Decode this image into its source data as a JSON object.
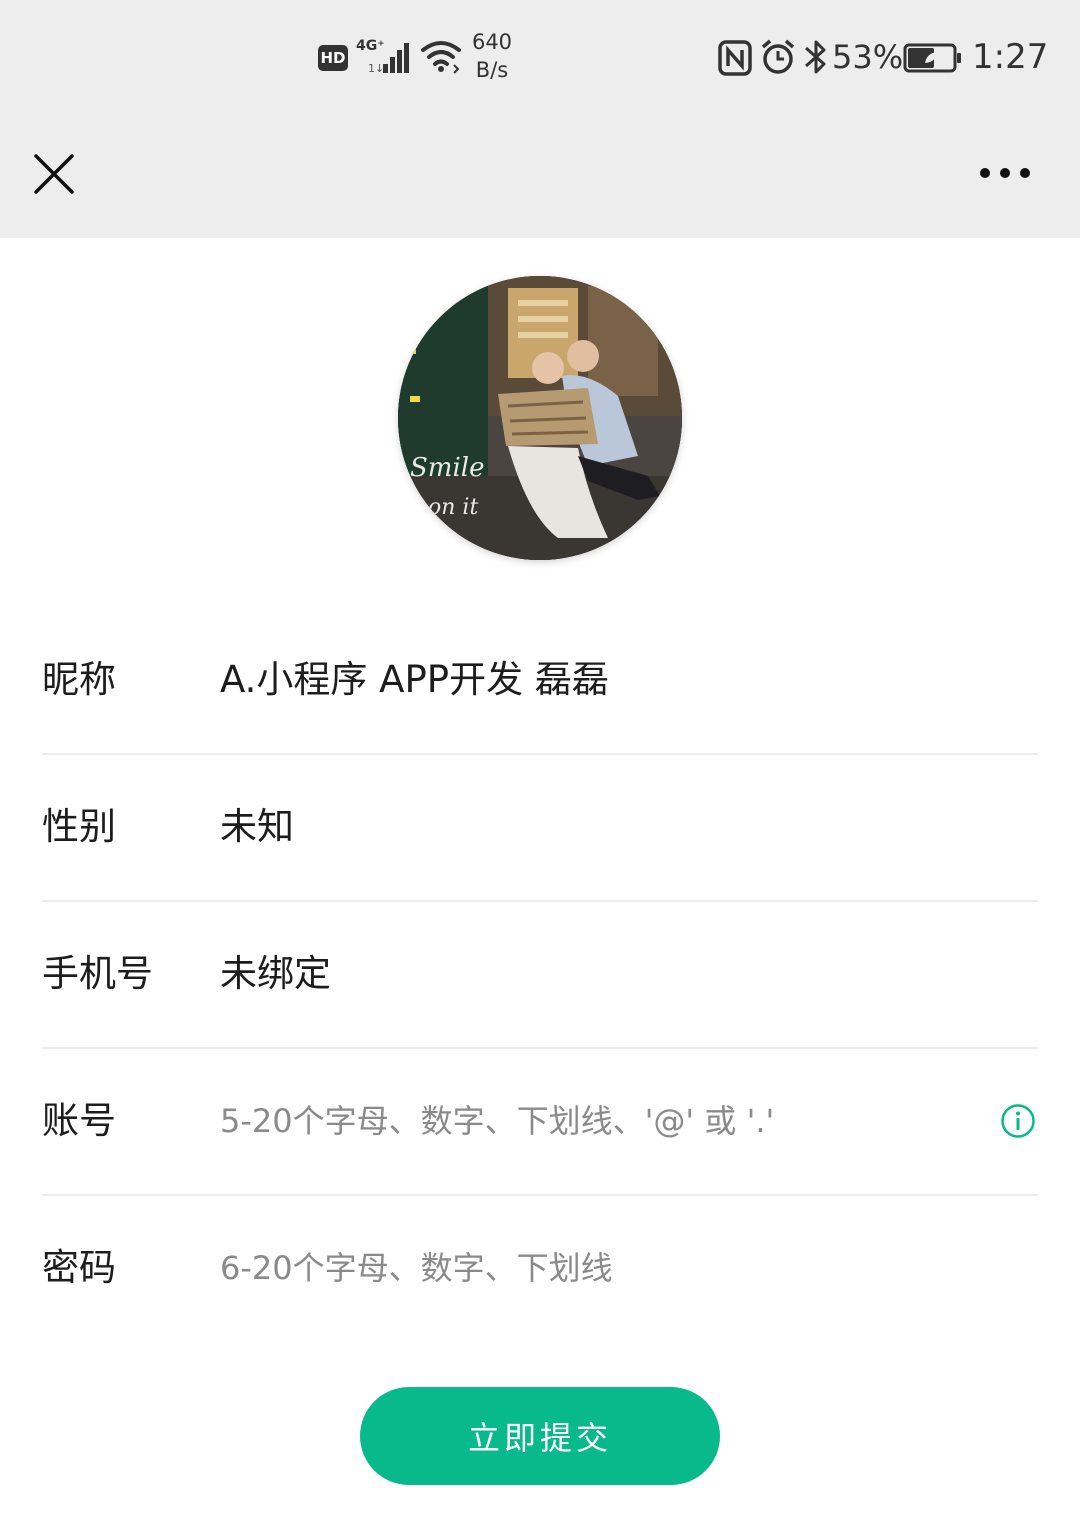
{
  "status_bar": {
    "hd_badge": "HD",
    "network_type": "4G⁺",
    "net_speed_value": "640",
    "net_speed_unit": "B/s",
    "battery_percent": "53%",
    "time": "1:27",
    "icons": [
      "hd-icon",
      "signal-icon",
      "wifi-icon",
      "nfc-icon",
      "alarm-icon",
      "bluetooth-icon",
      "battery-icon"
    ]
  },
  "nav": {
    "close_icon": "close-icon",
    "more_icon": "more-icon"
  },
  "profile": {
    "avatar_icon": "avatar-photo"
  },
  "form": {
    "nickname": {
      "label": "昵称",
      "value": "A.小程序 APP开发 磊磊"
    },
    "gender": {
      "label": "性别",
      "value": "未知"
    },
    "phone": {
      "label": "手机号",
      "value": "未绑定"
    },
    "account": {
      "label": "账号",
      "value": "",
      "placeholder": "5-20个字母、数字、下划线、'@' 或 '.'",
      "info_icon": "info-icon"
    },
    "password": {
      "label": "密码",
      "value": "",
      "placeholder": "6-20个字母、数字、下划线"
    }
  },
  "submit": {
    "label": "立即提交"
  },
  "colors": {
    "accent": "#07b98b",
    "top_background": "#ededed",
    "page_background": "#ffffff",
    "divider": "#ececec",
    "placeholder_text": "#8a8a8a"
  }
}
